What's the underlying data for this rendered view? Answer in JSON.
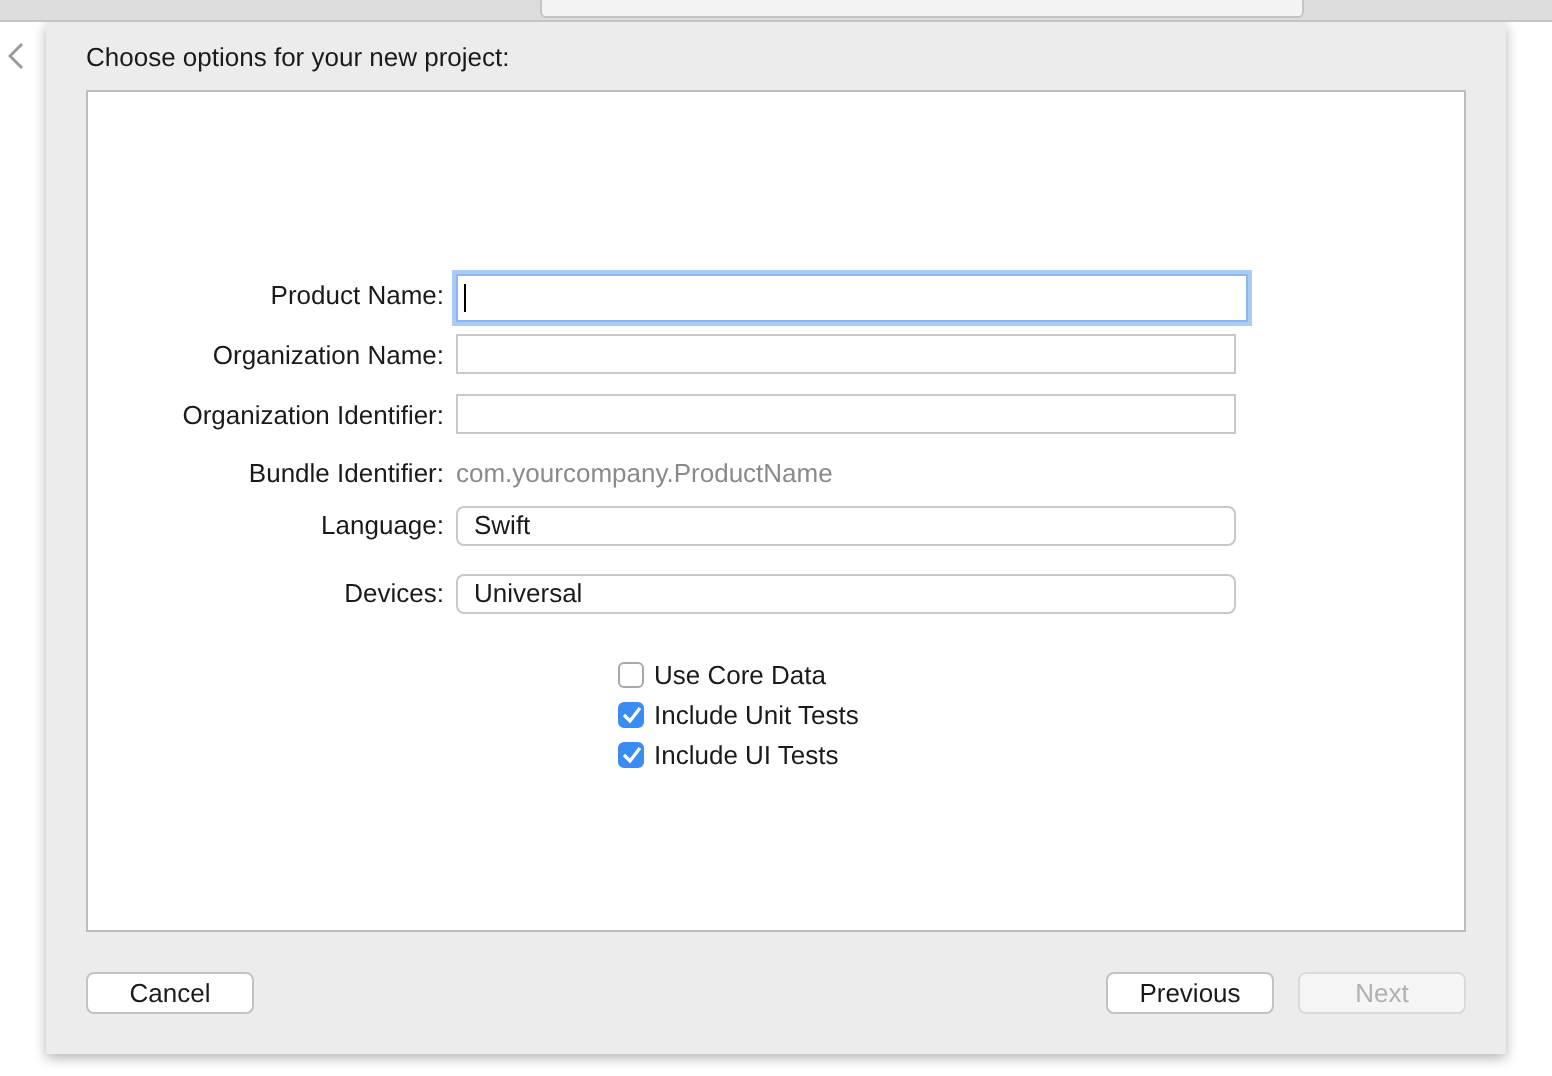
{
  "window": {
    "title": "Choose options for your new project:"
  },
  "fields": [
    {
      "label": "Product Name:",
      "kind": "text",
      "focused": true
    },
    {
      "label": "Organization Name:",
      "kind": "text",
      "focused": false
    },
    {
      "label": "Organization Identifier:",
      "kind": "text",
      "focused": false
    },
    {
      "label": "Bundle Identifier:",
      "kind": "static",
      "value": "com.yourcompany.ProductName"
    },
    {
      "label": "Language:",
      "kind": "popup",
      "value": "Swift"
    },
    {
      "label": "Devices:",
      "kind": "popup",
      "value": "Universal"
    }
  ],
  "options": [
    {
      "label": "Use Core Data",
      "checked": false
    },
    {
      "label": "Include Unit Tests",
      "checked": true
    },
    {
      "label": "Include UI Tests",
      "checked": true
    }
  ],
  "buttons": [
    {
      "label": "Cancel",
      "disabled": false
    },
    {
      "label": "Previous",
      "disabled": false
    },
    {
      "label": "Next",
      "disabled": true
    }
  ]
}
